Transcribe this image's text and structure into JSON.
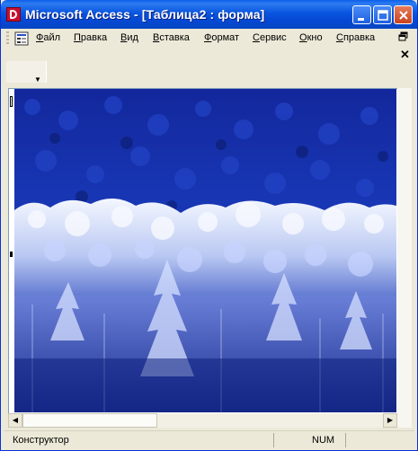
{
  "window": {
    "title": "Microsoft Access - [Таблица2 : форма]"
  },
  "menu": {
    "items": [
      "Файл",
      "Правка",
      "Вид",
      "Вставка",
      "Формат",
      "Сервис",
      "Окно",
      "Справка"
    ]
  },
  "mdi": {
    "restore_icon": "restore-icon",
    "close_label": "✕"
  },
  "form": {
    "image_desc_icon": "photo-icon"
  },
  "status": {
    "mode": "Конструктор",
    "num": "NUM"
  },
  "colors": {
    "titlebar": "#0a55e0",
    "photo_sky": "#1530a8",
    "snow": "#e4ecff"
  }
}
